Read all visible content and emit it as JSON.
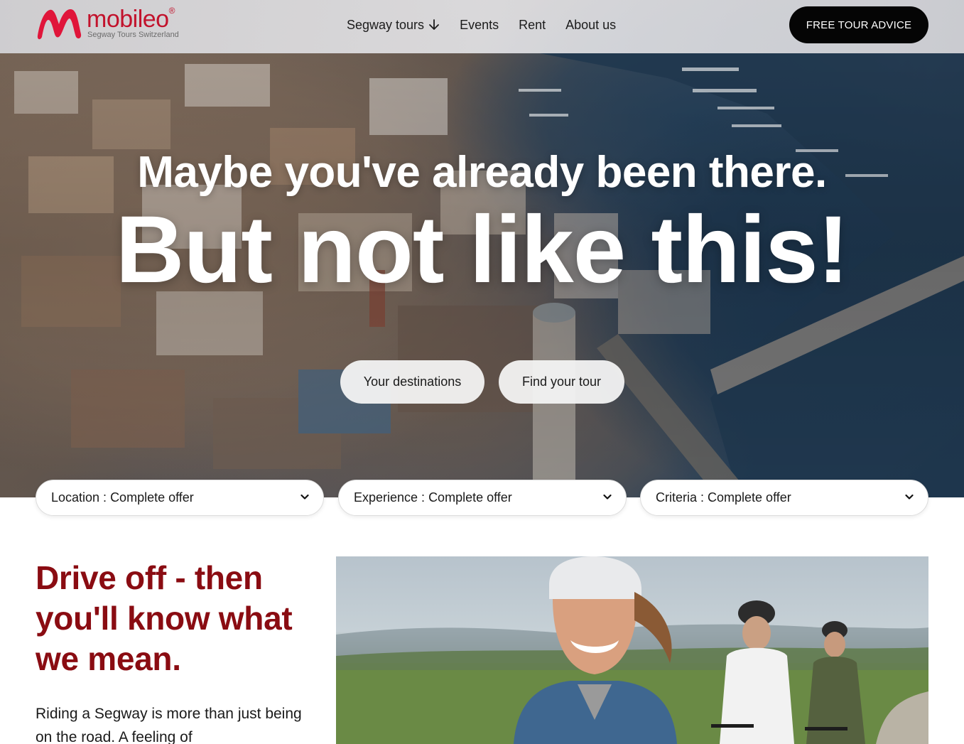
{
  "brand": {
    "name": "mobileo",
    "registered": "®",
    "tagline": "Segway Tours Switzerland",
    "color": "#c2122c"
  },
  "nav": {
    "items": [
      {
        "label": "Segway tours",
        "has_dropdown": true,
        "icon": "arrow-down-icon"
      },
      {
        "label": "Events"
      },
      {
        "label": "Rent"
      },
      {
        "label": "About us"
      }
    ],
    "cta": "FREE TOUR ADVICE"
  },
  "hero": {
    "line1": "Maybe you've already been there.",
    "line2": "But not like this!",
    "buttons": [
      "Your destinations",
      "Find your tour"
    ]
  },
  "filters": [
    {
      "key": "Location : ",
      "value": "Complete offer"
    },
    {
      "key": "Experience : ",
      "value": "Complete offer"
    },
    {
      "key": "Criteria : ",
      "value": "Complete offer"
    }
  ],
  "section": {
    "title": "Drive off - then you'll know what we mean.",
    "text": "Riding a Segway is more than just being on the road.  A feeling of",
    "title_color": "#8a0c12"
  }
}
